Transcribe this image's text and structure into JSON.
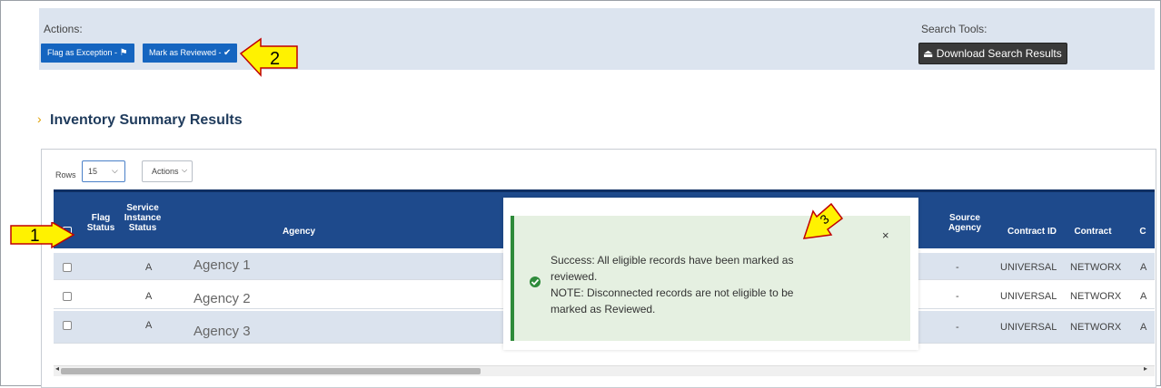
{
  "actions": {
    "label": "Actions:",
    "flag_button": "Flag as Exception -",
    "review_button": "Mark as Reviewed -"
  },
  "search_tools": {
    "label": "Search Tools:",
    "download_button": "Download Search Results"
  },
  "section_title": "Inventory Summary Results",
  "rows_control": {
    "label": "Rows",
    "value": "15",
    "actions_label": "Actions"
  },
  "table": {
    "headers": {
      "flag_status": "Flag Status",
      "service_instance_status": "Service Instance Status",
      "agency": "Agency",
      "source_agency": "Source Agency",
      "contract_id": "Contract ID",
      "contract": "Contract",
      "c": "C"
    },
    "rows": [
      {
        "status": "A",
        "agency": "Agency 1",
        "source_agency": "-",
        "contract_id": "UNIVERSAL",
        "contract": "NETWORX",
        "c": "A"
      },
      {
        "status": "A",
        "agency": "Agency 2",
        "source_agency": "-",
        "contract_id": "UNIVERSAL",
        "contract": "NETWORX",
        "c": "A"
      },
      {
        "status": "A",
        "agency": "Agency 3",
        "source_agency": "-",
        "contract_id": "UNIVERSAL",
        "contract": "NETWORX",
        "c": "A"
      }
    ]
  },
  "toast": {
    "line1": "Success: All eligible records have been marked as",
    "line2": "reviewed.",
    "line3": "NOTE: Disconnected records are not eligible to be",
    "line4": "marked as Reviewed.",
    "close": "×"
  },
  "callouts": {
    "c1": "1",
    "c2": "2",
    "c3": "3"
  },
  "colors": {
    "header_blue": "#1e4a8c",
    "button_blue": "#1565c0",
    "success_green": "#2e8b3a",
    "callout_yellow": "#fff200"
  }
}
